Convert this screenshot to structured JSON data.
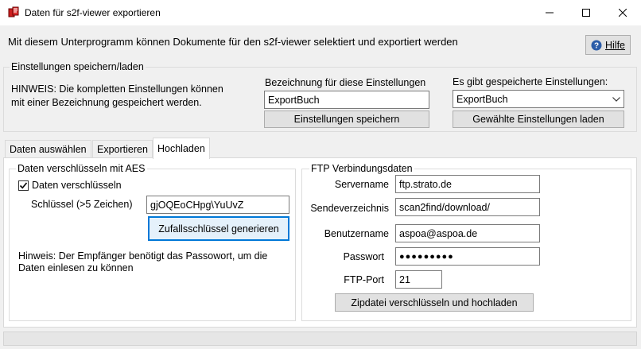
{
  "window": {
    "title": "Daten für s2f-viewer exportieren"
  },
  "intro_text": "Mit diesem Unterprogramm können Dokumente für den s2f-viewer selektiert und exportiert werden",
  "help_button": {
    "label": "Hilfe",
    "icon": "help-icon"
  },
  "settings_group": {
    "title": "Einstellungen speichern/laden",
    "hint_line1": "HINWEIS: Die kompletten Einstellungen können",
    "hint_line2": "mit einer Bezeichnung gespeichert werden.",
    "name_label": "Bezeichnung für diese Einstellungen",
    "name_value": "ExportBuch",
    "save_button": "Einstellungen speichern",
    "saved_label": "Es gibt gespeicherte Einstellungen:",
    "saved_value": "ExportBuch",
    "load_button": "Gewählte Einstellungen laden"
  },
  "tabs": [
    {
      "label": "Daten auswählen",
      "active": false
    },
    {
      "label": "Exportieren",
      "active": false
    },
    {
      "label": "Hochladen",
      "active": true
    }
  ],
  "encrypt_group": {
    "title": "Daten verschlüsseln mit AES",
    "checkbox_label": "Daten verschlüsseln",
    "checked": true,
    "key_label": "Schlüssel (>5 Zeichen)",
    "key_value": "gjOQEoCHpg\\YuUvZ",
    "generate_button": "Zufallsschlüssel generieren",
    "hint_line1": "Hinweis: Der Empfänger benötigt das Passowort, um die",
    "hint_line2": "Daten einlesen zu können"
  },
  "ftp_group": {
    "title": "FTP Verbindungsdaten",
    "server_label": "Servername",
    "server_value": "ftp.strato.de",
    "dir_label": "Sendeverzeichnis",
    "dir_value": "scan2find/download/",
    "user_label": "Benutzername",
    "user_value": "aspoa@aspoa.de",
    "password_label": "Passwort",
    "password_value": "●●●●●●●●●",
    "port_label": "FTP-Port",
    "port_value": "21",
    "upload_button": "Zipdatei verschlüsseln und hochladen"
  }
}
